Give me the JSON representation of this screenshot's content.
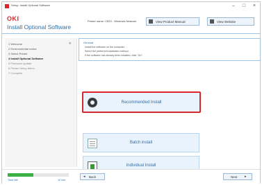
{
  "window": {
    "title": "Setup: Install Optional Software",
    "controls": {
      "minimize": "–",
      "maximize": "□",
      "close": "×"
    }
  },
  "header": {
    "brand": "OKI",
    "app_title": "Install Optional Software",
    "printer_name": "Printer name: C824 - Windows Network",
    "view_manual_label": "View Product Manual",
    "website_label": "View Website"
  },
  "sidebar": {
    "close_glyph": "«",
    "steps": [
      {
        "label": "1 Welcome",
        "state": "done"
      },
      {
        "label": "2 Environmental notice",
        "state": "done"
      },
      {
        "label": "3 Select Printer",
        "state": "done"
      },
      {
        "label": "4 Install Optional Software",
        "state": "active"
      },
      {
        "label": "5 Firmware update",
        "state": "pending"
      },
      {
        "label": "6 Printer Setup Menu",
        "state": "pending"
      },
      {
        "label": "7 Complete",
        "state": "pending"
      }
    ]
  },
  "general": {
    "title": "General",
    "lines": [
      "Install the software on the computer.",
      "Select the preferred installation method.",
      "If the software has already been installed, click \"Go\"."
    ]
  },
  "options": {
    "recommended": {
      "label": "Recommended Install",
      "icon": "disc-icon",
      "selected": true
    },
    "batch": {
      "label": "Batch install",
      "icon": "list-icon"
    },
    "individual": {
      "label": "Individual Install",
      "icon": "pick-icon"
    }
  },
  "footer": {
    "progress": 0.42,
    "time_left_label": "Time left:",
    "time_left_value": "10 min",
    "back_label": "Back",
    "next_label": "Next",
    "back_arrow": "◂",
    "next_arrow": "▸"
  },
  "colors": {
    "accent": "#2e6fa8",
    "brand": "#d9262c",
    "highlight": "#d9262c",
    "progress": "#3cb043"
  }
}
